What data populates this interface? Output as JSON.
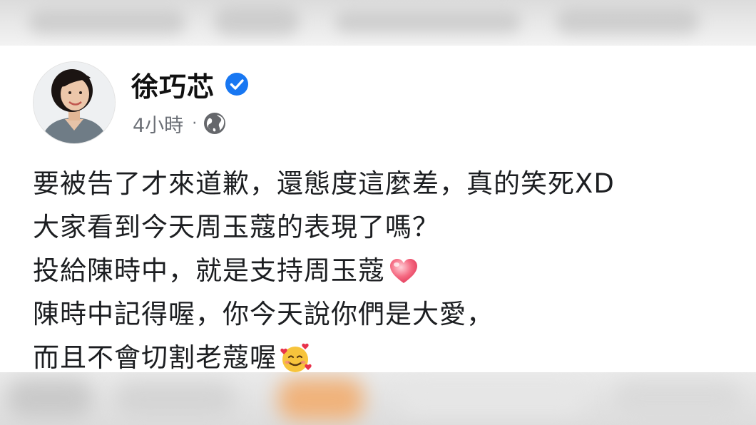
{
  "post": {
    "author_name": "徐巧芯",
    "verified_icon": "verified-badge-icon",
    "timestamp": "4小時",
    "separator": "·",
    "audience_icon": "globe-icon",
    "lines": [
      {
        "text": "要被告了才來道歉，還態度這麼差，真的笑死XD"
      },
      {
        "text": "大家看到今天周玉蔻的表現了嗎？"
      },
      {
        "text": "投給陳時中，就是支持周玉蔻",
        "emoji": "heart-icon"
      },
      {
        "text": "陳時中記得喔，你今天說你們是大愛，"
      },
      {
        "text": "而且不會切割老蔻喔",
        "emoji": "smiling-face-with-hearts-icon"
      }
    ]
  },
  "colors": {
    "name": "#111111",
    "meta": "#6b6f76",
    "body": "#1c1e21",
    "verified_blue": "#1877f2",
    "heart": "#f0556f"
  }
}
